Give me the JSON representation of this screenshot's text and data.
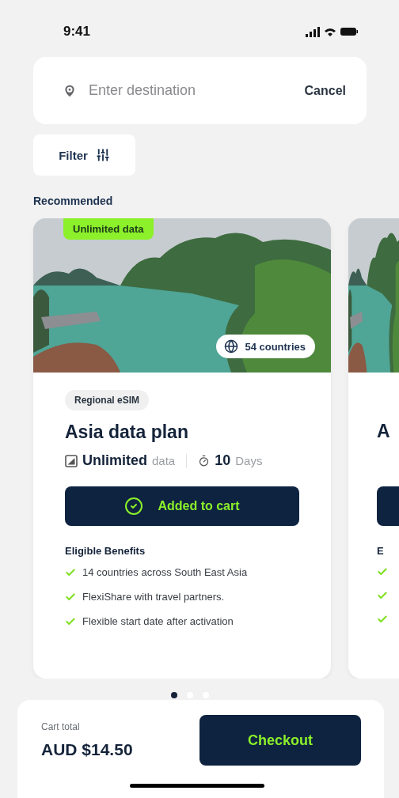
{
  "status_bar": {
    "time": "9:41"
  },
  "search": {
    "placeholder": "Enter destination",
    "cancel": "Cancel"
  },
  "filter": {
    "label": "Filter"
  },
  "section_title": "Recommended",
  "plan": {
    "badge": "Unlimited data",
    "coverage": "54 countries",
    "tag": "Regional eSIM",
    "title": "Asia data plan",
    "data_amount": "Unlimited",
    "data_unit": "data",
    "duration": "10",
    "duration_unit": "Days",
    "button": "Added to cart",
    "in_cart": true,
    "benefits_title": "Eligible Benefits",
    "benefits": [
      "14 countries across South East Asia",
      "FlexiShare with travel partners.",
      "Flexible start date after activation"
    ]
  },
  "next_plan": {
    "title": "A",
    "benefits_title": "E"
  },
  "pagination": [
    {
      "selected": true
    },
    {
      "selected": false
    },
    {
      "selected": false
    }
  ],
  "cart": {
    "label": "Cart total",
    "total": "AUD $14.50",
    "button": "Checkout"
  }
}
